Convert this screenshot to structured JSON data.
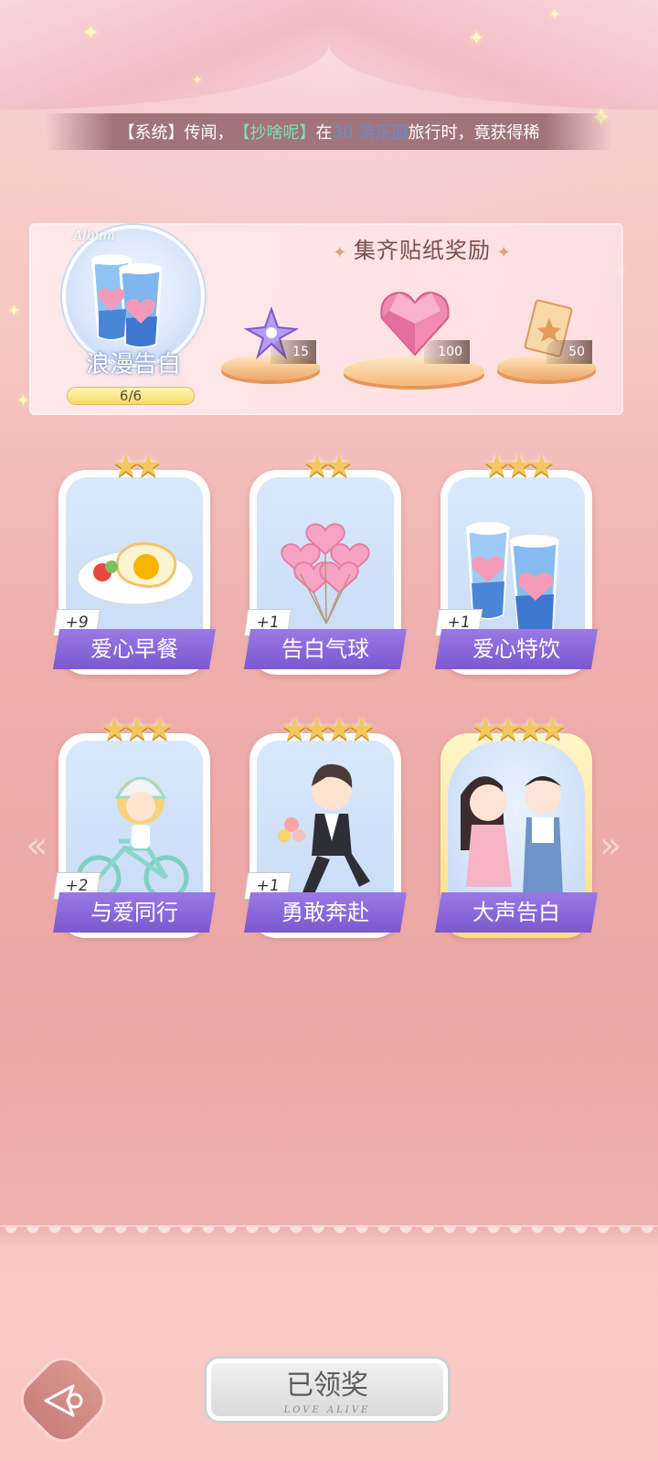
{
  "announcement": {
    "prefix": "【系统】传闻，",
    "player": "【抄啥呢】",
    "mid": "在",
    "level": "30",
    "place": "游乐园",
    "suffix": "旅行时，竟获得稀"
  },
  "album": {
    "script_label": "Album",
    "name": "浪漫告白",
    "progress_text": "6/6",
    "progress_fraction": 1.0
  },
  "rewards": {
    "title": "集齐贴纸奖励",
    "items": [
      {
        "icon": "purple-flower-icon",
        "qty": "15"
      },
      {
        "icon": "pink-heart-gem-icon",
        "qty": "100"
      },
      {
        "icon": "paper-card-icon",
        "qty": "50"
      }
    ]
  },
  "stickers": [
    {
      "name": "爱心早餐",
      "count": "+9",
      "stars": 2,
      "icon": "breakfast-plate-icon"
    },
    {
      "name": "告白气球",
      "count": "+1",
      "stars": 2,
      "icon": "heart-balloons-icon"
    },
    {
      "name": "爱心特饮",
      "count": "+1",
      "stars": 3,
      "icon": "heart-drinks-icon"
    },
    {
      "name": "与爱同行",
      "count": "+2",
      "stars": 3,
      "icon": "girl-bicycle-icon"
    },
    {
      "name": "勇敢奔赴",
      "count": "+1",
      "stars": 4,
      "icon": "running-boy-icon"
    },
    {
      "name": "大声告白",
      "count": "",
      "stars": 4,
      "icon": "couple-icon"
    }
  ],
  "navigation": {
    "prev": "«",
    "next": "»"
  },
  "claim_button": {
    "label": "已领奖",
    "sub": "LOVE ALIVE"
  },
  "colors": {
    "ribbon": "#8a66da",
    "star": "#f3c85e",
    "background": "#eba7a5"
  }
}
